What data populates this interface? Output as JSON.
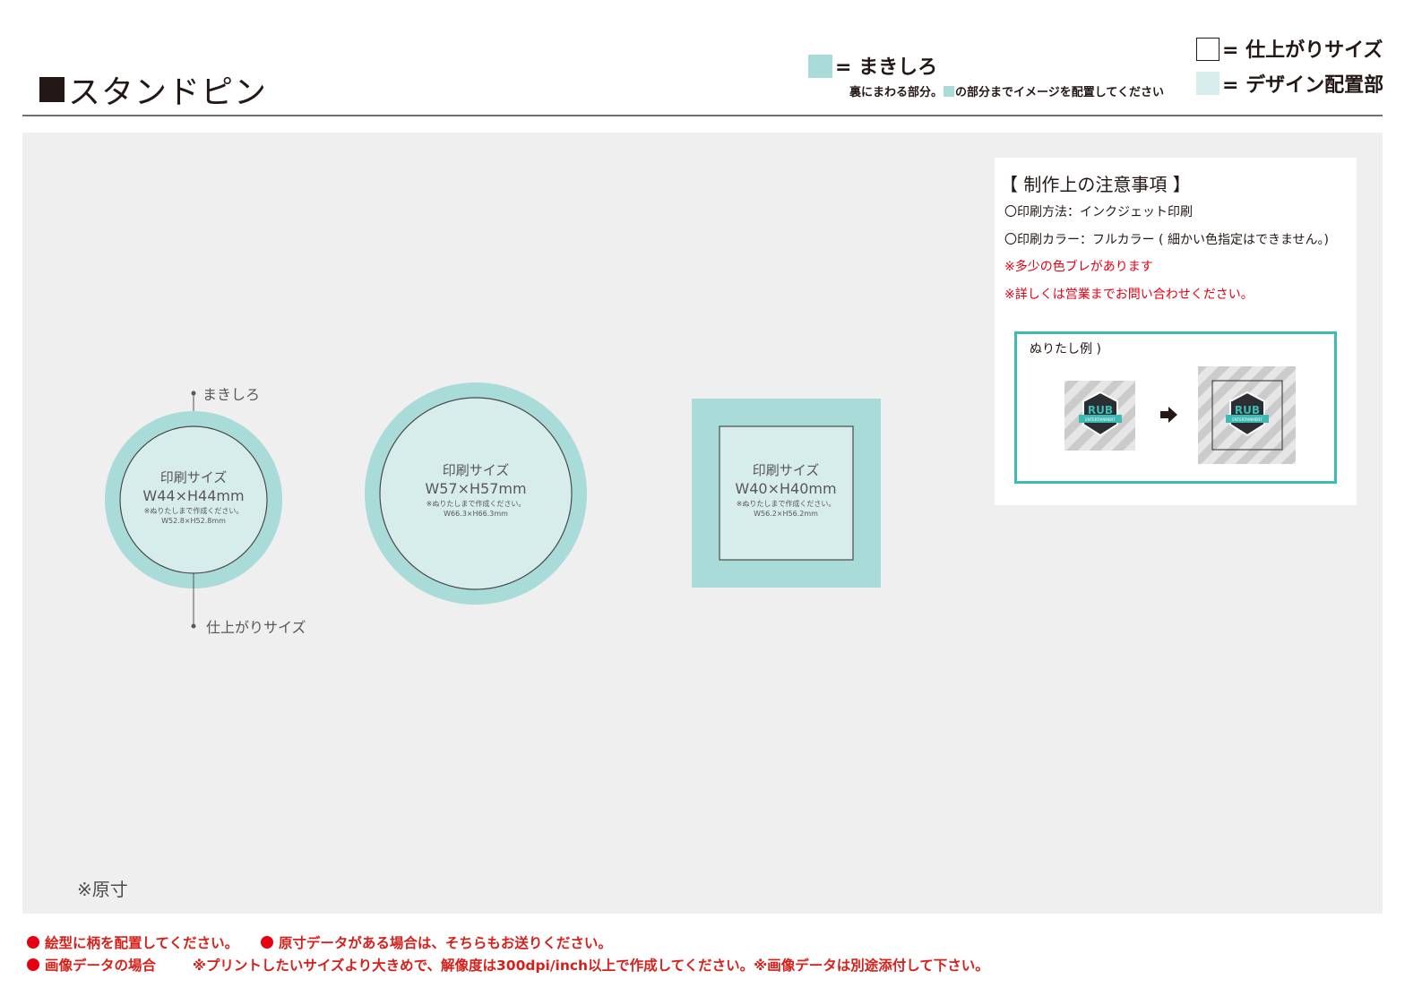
{
  "header": {
    "title": "スタンドピン"
  },
  "legend": {
    "bleed_label": "= まきしろ",
    "bleed_note_pre": "裏にまわる部分。",
    "bleed_note_post": "の部分までイメージを配置してください",
    "finish_label": "= 仕上がりサイズ",
    "design_label": "= デザイン配置部",
    "colors": {
      "bleed": "#a9dbd8",
      "design": "#d6edeb"
    }
  },
  "shapes": [
    {
      "label": "印刷サイズ",
      "size": "W44×H44mm",
      "note": "※ぬりたしまで作成ください。",
      "bleed_size": "W52.8×H52.8mm"
    },
    {
      "label": "印刷サイズ",
      "size": "W57×H57mm",
      "note": "※ぬりたしまで作成ください。",
      "bleed_size": "W66.3×H66.3mm"
    },
    {
      "label": "印刷サイズ",
      "size": "W40×H40mm",
      "note": "※ぬりたしまで作成ください。",
      "bleed_size": "W56.2×H56.2mm"
    }
  ],
  "callouts": {
    "bleed": "まきしろ",
    "finish": "仕上がりサイズ"
  },
  "notes": {
    "title": "【 制作上の注意事項 】",
    "lines": [
      "〇印刷方法：インクジェット印刷",
      "〇印刷カラー：フルカラー ( 細かい色指定はできません。)"
    ],
    "warnings": [
      "※多少の色ブレがあります",
      "※詳しくは営業までお問い合わせください。"
    ],
    "example_label": "ぬりたし例 )",
    "logo_text": "RUB",
    "logo_band": "ENTERTAINMENT"
  },
  "genten": "※原寸",
  "footer": {
    "line1_a": "絵型に柄を配置してください。",
    "line1_b": "原寸データがある場合は、そちらもお送りください。",
    "line2_a": "画像データの場合",
    "line2_b": "※プリントしたいサイズより大きめで、解像度は300dpi/inch以上で作成してください。※画像データは別途添付して下さい。"
  }
}
